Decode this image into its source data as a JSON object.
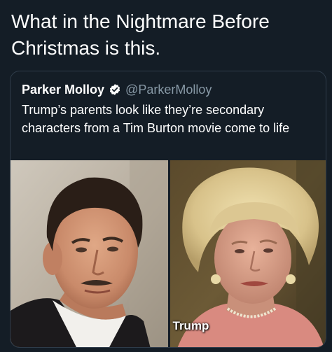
{
  "headline": "What in the Nightmare Before Christmas is this.",
  "tweet": {
    "author_name": "Parker Molloy",
    "handle": "@ParkerMolloy",
    "text": "Trump’s parents look like they’re secondary characters from a Tim Burton movie come to life",
    "verified_icon": "verified-badge-icon"
  },
  "media": {
    "left_photo": "man-portrait",
    "right_photo": "woman-portrait",
    "right_caption": "Trump"
  },
  "colors": {
    "background": "#141d26",
    "card_border": "#2f3c4a",
    "handle_text": "#8899a6",
    "text": "#ffffff"
  }
}
